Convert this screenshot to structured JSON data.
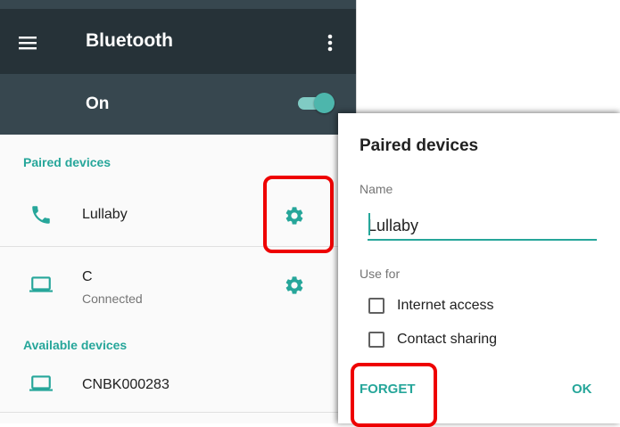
{
  "app_bar": {
    "title": "Bluetooth",
    "menu_icon": "hamburger-menu-icon",
    "overflow_icon": "more-vert-icon"
  },
  "master_switch": {
    "label": "On",
    "enabled": true
  },
  "paired_section": {
    "header": "Paired devices",
    "devices": [
      {
        "name": "Lullaby",
        "status": "",
        "icon": "phone-icon",
        "settings_icon": "gear-icon"
      },
      {
        "name": "C",
        "status": "Connected",
        "icon": "laptop-icon",
        "settings_icon": "gear-icon"
      }
    ]
  },
  "available_section": {
    "header": "Available devices",
    "devices": [
      {
        "name": "CNBK000283",
        "icon": "laptop-icon"
      }
    ]
  },
  "dialog": {
    "title": "Paired devices",
    "name_label": "Name",
    "name_value": "Lullaby",
    "use_for_label": "Use for",
    "options": [
      {
        "label": "Internet access",
        "checked": false
      },
      {
        "label": "Contact sharing",
        "checked": false
      }
    ],
    "forget_label": "FORGET",
    "ok_label": "OK"
  },
  "colors": {
    "accent": "#26a69a",
    "app_bar": "#263238",
    "switch_bar": "#37474f",
    "highlight": "#ee0000"
  }
}
